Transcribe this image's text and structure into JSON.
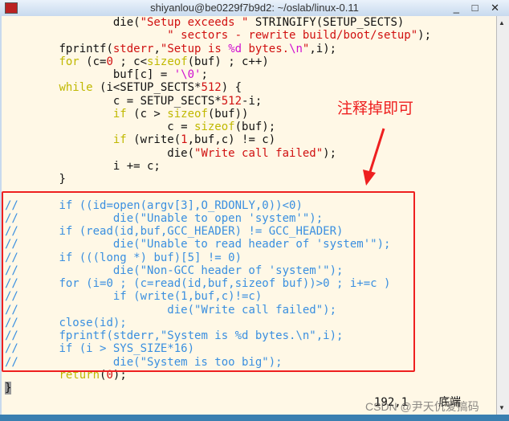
{
  "window": {
    "title": "shiyanlou@be0229f7b9d2: ~/oslab/linux-0.11",
    "buttons": "_ □ ✕"
  },
  "code_lines": [
    [
      [
        "",
        "\t\tdie("
      ],
      [
        "s",
        "\"Setup exceeds \""
      ],
      [
        "",
        " STRINGIFY(SETUP_SECTS)"
      ]
    ],
    [
      [
        "",
        "\t\t\t"
      ],
      [
        "s",
        "\" sectors - rewrite build/boot/setup\""
      ],
      [
        "",
        ");"
      ]
    ],
    [
      [
        "",
        "\tfprintf("
      ],
      [
        "s",
        "stderr"
      ],
      [
        "",
        ","
      ],
      [
        "s",
        "\"Setup is "
      ],
      [
        "m",
        "%d"
      ],
      [
        "s",
        " bytes."
      ],
      [
        "m",
        "\\n"
      ],
      [
        "s",
        "\""
      ],
      [
        "",
        ",i);"
      ]
    ],
    [
      [
        "k",
        "\tfor"
      ],
      [
        "",
        " (c="
      ],
      [
        "n",
        "0"
      ],
      [
        "",
        " ; c<"
      ],
      [
        "k",
        "sizeof"
      ],
      [
        "",
        "(buf) ; c++)"
      ]
    ],
    [
      [
        "",
        "\t\tbuf[c] = "
      ],
      [
        "m",
        "'\\0'"
      ],
      [
        "",
        ";"
      ]
    ],
    [
      [
        "k",
        "\twhile"
      ],
      [
        "",
        " (i<SETUP_SECTS*"
      ],
      [
        "n",
        "512"
      ],
      [
        "",
        ") {"
      ]
    ],
    [
      [
        "",
        "\t\tc = SETUP_SECTS*"
      ],
      [
        "n",
        "512"
      ],
      [
        "",
        "-i;"
      ]
    ],
    [
      [
        "k",
        "\t\tif"
      ],
      [
        "",
        " (c > "
      ],
      [
        "k",
        "sizeof"
      ],
      [
        "",
        "(buf))"
      ]
    ],
    [
      [
        "",
        "\t\t\tc = "
      ],
      [
        "k",
        "sizeof"
      ],
      [
        "",
        "(buf);"
      ]
    ],
    [
      [
        "k",
        "\t\tif"
      ],
      [
        "",
        " (write("
      ],
      [
        "n",
        "1"
      ],
      [
        "",
        ",buf,c) != c)"
      ]
    ],
    [
      [
        "",
        "\t\t\tdie("
      ],
      [
        "s",
        "\"Write call failed\""
      ],
      [
        "",
        ");"
      ]
    ],
    [
      [
        "",
        "\t\ti += c;"
      ]
    ],
    [
      [
        "",
        "\t}"
      ]
    ],
    [
      [
        "",
        ""
      ]
    ],
    [
      [
        "c",
        "//\tif ((id=open(argv[3],O_RDONLY,0))<0)"
      ]
    ],
    [
      [
        "c",
        "//\t\tdie(\"Unable to open 'system'\");"
      ]
    ],
    [
      [
        "c",
        "//\tif (read(id,buf,GCC_HEADER) != GCC_HEADER)"
      ]
    ],
    [
      [
        "c",
        "//\t\tdie(\"Unable to read header of 'system'\");"
      ]
    ],
    [
      [
        "c",
        "//\tif (((long *) buf)[5] != 0)"
      ]
    ],
    [
      [
        "c",
        "//\t\tdie(\"Non-GCC header of 'system'\");"
      ]
    ],
    [
      [
        "c",
        "//\tfor (i=0 ; (c=read(id,buf,sizeof buf))>0 ; i+=c )"
      ]
    ],
    [
      [
        "c",
        "//\t\tif (write(1,buf,c)!=c)"
      ]
    ],
    [
      [
        "c",
        "//\t\t\tdie(\"Write call failed\");"
      ]
    ],
    [
      [
        "c",
        "//\tclose(id);"
      ]
    ],
    [
      [
        "c",
        "//\tfprintf(stderr,\"System is %d bytes.\\n\",i);"
      ]
    ],
    [
      [
        "c",
        "//\tif (i > SYS_SIZE*16)"
      ]
    ],
    [
      [
        "c",
        "//\t\tdie(\"System is too big\");"
      ]
    ],
    [
      [
        "k",
        "\treturn"
      ],
      [
        "",
        "("
      ],
      [
        "n",
        "0"
      ],
      [
        "",
        ");"
      ]
    ],
    [
      [
        "cursor",
        "}"
      ]
    ]
  ],
  "annotation": "注释掉即可",
  "status": {
    "position": "192,1",
    "scroll": "底端"
  },
  "watermark": "CSDN @尹天仇爱搞码",
  "colors": {
    "keyword": "#c0b800",
    "string": "#d01010",
    "special": "#d010d0",
    "comment": "#3a8fe0",
    "background": "#fff8e6",
    "highlight": "#ee2020"
  }
}
